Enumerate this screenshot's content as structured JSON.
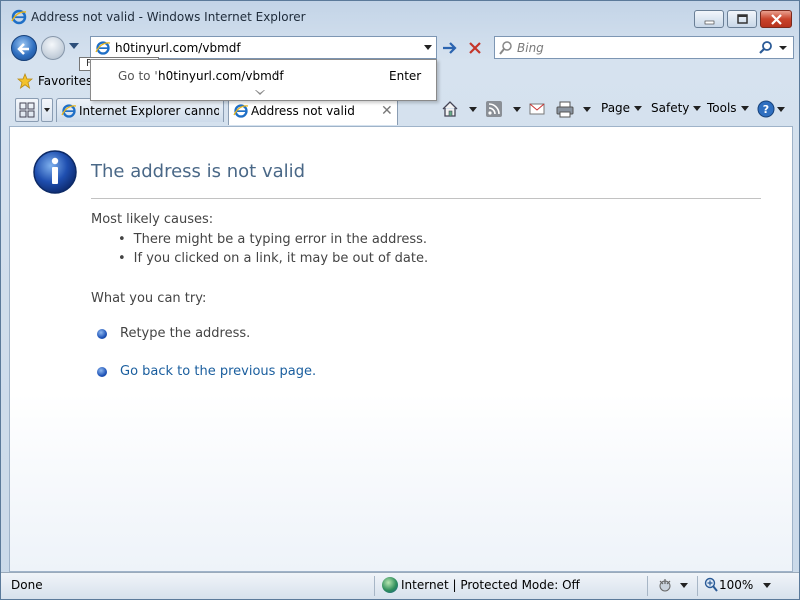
{
  "window": {
    "title": "Address not valid - Windows Internet Explorer"
  },
  "navbar": {
    "address_value": "h0tinyurl.com/vbmdf",
    "search_placeholder": "Bing"
  },
  "address_popup": {
    "goto_prefix": "Go to '",
    "url": "h0tinyurl.com/vbmdf",
    "goto_suffix": "'",
    "enter_label": "Enter"
  },
  "favorites": {
    "label": "Favorites",
    "tooltip_stub": "F"
  },
  "tabs": [
    {
      "label": "Internet Explorer cannot ...",
      "active": false
    },
    {
      "label": "Address not valid",
      "active": true
    }
  ],
  "command_bar": {
    "page_label": "Page",
    "safety_label": "Safety",
    "tools_label": "Tools"
  },
  "content": {
    "title": "The address is not valid",
    "causes_heading": "Most likely causes:",
    "causes": [
      "There might be a typing error in the address.",
      "If you clicked on a link, it may be out of date."
    ],
    "try_heading": "What you can try:",
    "try_items": [
      "Retype the address.",
      "Go back to the previous page."
    ]
  },
  "statusbar": {
    "status": "Done",
    "zone": "Internet | Protected Mode: Off",
    "zoom": "100%"
  },
  "colors": {
    "title_blue": "#4a6887",
    "link_blue": "#1a5e9e",
    "chrome_bg": "#cfdbe8"
  },
  "icons": [
    "ie-icon",
    "back-icon",
    "forward-icon",
    "go-icon",
    "stop-icon",
    "search-icon",
    "favorites-star-icon",
    "quick-tabs-icon",
    "home-icon",
    "feeds-icon",
    "read-mail-icon",
    "print-icon",
    "help-icon",
    "info-icon",
    "internet-zone-icon",
    "popup-blocker-icon",
    "zoom-icon"
  ]
}
